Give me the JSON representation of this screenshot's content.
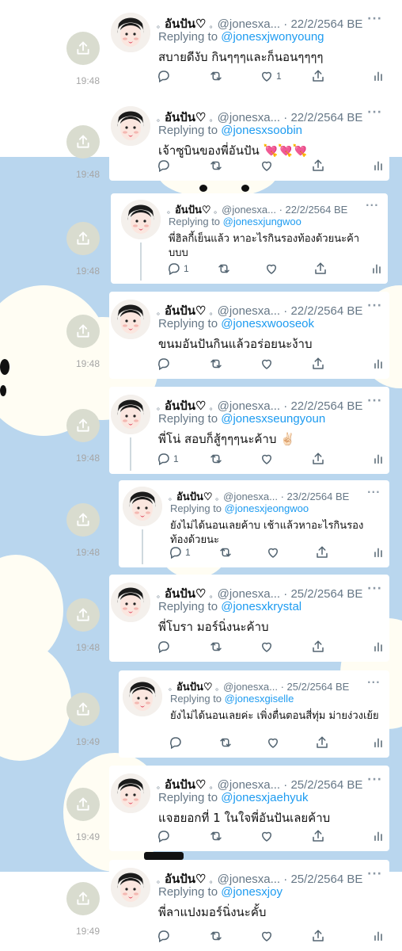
{
  "author_name": "อันปัน♡",
  "tweets": [
    {
      "handle": "@jonesxa...",
      "date": "22/2/2564 BE",
      "reply_label": "Replying to",
      "reply_to": "@jonesxjwonyoung",
      "text": "สบายดีงับ กินๆๆๆและก็นอนๆๆๆๆ",
      "reply_count": "",
      "like_count": "1",
      "time": "19:48"
    },
    {
      "handle": "@jonesxa...",
      "date": "22/2/2564 BE",
      "reply_label": "Replying to",
      "reply_to": "@jonesxsoobin",
      "text": "เจ้าซูบินของพี่อันปัน 💘💘💘",
      "reply_count": "",
      "like_count": "",
      "time": "19:48"
    },
    {
      "handle": "@jonesxa...",
      "date": "22/2/2564 BE",
      "reply_label": "Replying to",
      "reply_to": "@jonesxjungwoo",
      "text": "พี่ฮิลกี้เย็นแล้ว หาอะไรกินรองท้องด้วยนะค้า บบบ",
      "reply_count": "1",
      "like_count": "",
      "time": "19:48"
    },
    {
      "handle": "@jonesxa...",
      "date": "22/2/2564 BE",
      "reply_label": "Replying to",
      "reply_to": "@jonesxwooseok",
      "text": "ขนมอันปันกินแล้วอร่อยนะง้าบ",
      "reply_count": "",
      "like_count": "",
      "time": "19:48"
    },
    {
      "handle": "@jonesxa...",
      "date": "22/2/2564 BE",
      "reply_label": "Replying to",
      "reply_to": "@jonesxseungyoun",
      "text": "พี่โน่ สอบก็สู้ๆๆๆนะค้าบ ✌🏻",
      "reply_count": "1",
      "like_count": "",
      "time": "19:48"
    },
    {
      "handle": "@jonesxa...",
      "date": "23/2/2564 BE",
      "reply_label": "Replying to",
      "reply_to": "@jonesxjeongwoo",
      "text": "ยังไม่ได้นอนเลยค้าบ เช้าแล้วหาอะไรกินรองท้องด้วยนะ",
      "reply_count": "1",
      "like_count": "",
      "time": "19:48"
    },
    {
      "handle": "@jonesxa...",
      "date": "25/2/2564 BE",
      "reply_label": "Replying to",
      "reply_to": "@jonesxkrystal",
      "text": "พี่โบรา มอร์นิ่งนะค้าบ",
      "reply_count": "",
      "like_count": "",
      "time": "19:48"
    },
    {
      "handle": "@jonesxa...",
      "date": "25/2/2564 BE",
      "reply_label": "Replying to",
      "reply_to": "@jonesxgiselle",
      "text": "ยังไม่ได้นอนเลยค่ะ เพิ่งตื่นตอนสี่ทุ่ม ม่ายง่วงเย้ย",
      "reply_count": "",
      "like_count": "",
      "time": "19:49"
    },
    {
      "handle": "@jonesxa...",
      "date": "25/2/2564 BE",
      "reply_label": "Replying to",
      "reply_to": "@jonesxjaehyuk",
      "text": "แจฮยอกที่ 1 ในใจพี่อันปันเลยค้าบ",
      "reply_count": "",
      "like_count": "",
      "time": "19:49"
    },
    {
      "handle": "@jonesxa...",
      "date": "25/2/2564 BE",
      "reply_label": "Replying to",
      "reply_to": "@jonesxjoy",
      "text": "พี่ลาแปงมอร์นิ่งนะคั้บ",
      "reply_count": "",
      "like_count": "",
      "time": "19:49"
    }
  ],
  "icons": {
    "share": "share-icon",
    "reply": "reply-icon",
    "retweet": "retweet-icon",
    "like": "heart-icon",
    "upload": "upload-icon",
    "analytics": "analytics-icon",
    "more": "more-icon"
  },
  "colors": {
    "link": "#1d9bf0",
    "background": "#b9d6ee",
    "cloud": "#fffdf3",
    "meta": "#667786"
  }
}
